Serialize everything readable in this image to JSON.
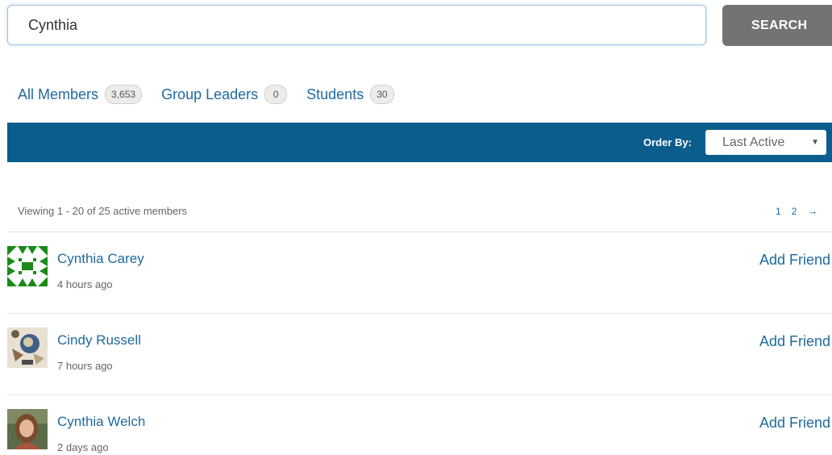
{
  "search": {
    "value": "Cynthia",
    "button_label": "SEARCH"
  },
  "tabs": [
    {
      "label": "All Members",
      "count": "3,653"
    },
    {
      "label": "Group Leaders",
      "count": "0"
    },
    {
      "label": "Students",
      "count": "30"
    }
  ],
  "order_bar": {
    "label": "Order By:",
    "selected": "Last Active",
    "caret": "▼",
    "color": "#0b5d8e"
  },
  "listing": {
    "viewing_text": "Viewing 1 - 20 of 25 active members",
    "pages": [
      "1",
      "2"
    ],
    "next_arrow": "→"
  },
  "members": [
    {
      "name": "Cynthia Carey",
      "last_active": "4 hours ago",
      "action": "Add Friend",
      "avatar": "green-geometric-identicon"
    },
    {
      "name": "Cindy Russell",
      "last_active": "7 hours ago",
      "action": "Add Friend",
      "avatar": "quilt-block-photo"
    },
    {
      "name": "Cynthia Welch",
      "last_active": "2 days ago",
      "action": "Add Friend",
      "avatar": "person-portrait-photo"
    }
  ],
  "colors": {
    "link": "#1f6a9c",
    "button": "#737373",
    "identicon": "#1a8a1a"
  }
}
